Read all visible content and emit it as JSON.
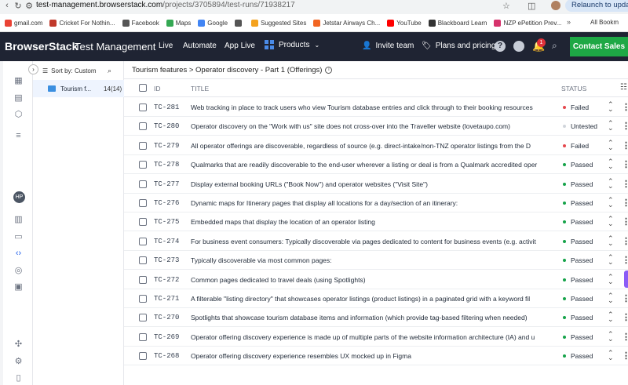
{
  "browser": {
    "url_host": "test-management.browserstack.com",
    "url_path": "/projects/3705894/test-runs/71938217",
    "relaunch_label": "Relaunch to update",
    "bookmarks": [
      {
        "label": "gmail.com",
        "color": "#ea4335"
      },
      {
        "label": "Cricket For Nothin...",
        "color": "#c0392b"
      },
      {
        "label": "Facebook",
        "color": "#555555"
      },
      {
        "label": "Maps",
        "color": "#34a853"
      },
      {
        "label": "Google",
        "color": "#4285f4"
      },
      {
        "label": "",
        "color": "#555555"
      },
      {
        "label": "Suggested Sites",
        "color": "#f4a21e"
      },
      {
        "label": "Jetstar Airways Ch...",
        "color": "#f26522"
      },
      {
        "label": "YouTube",
        "color": "#ff0000"
      },
      {
        "label": "Blackboard Learn",
        "color": "#333333"
      },
      {
        "label": "NZP ePetition Prev...",
        "color": "#d6336c"
      }
    ],
    "bookmarks_all": "All Bookm"
  },
  "topnav": {
    "logo": "BrowserStack",
    "product": "Test Management",
    "links": [
      "Live",
      "Automate",
      "App Live"
    ],
    "products_label": "Products",
    "invite_label": "Invite team",
    "plans_label": "Plans and pricing",
    "notification_count": "1",
    "contact_label": "Contact Sales",
    "help_glyph": "?"
  },
  "rail": {
    "avatar_initials": "HP"
  },
  "folders": {
    "sort_label": "Sort by: Custom",
    "items": [
      {
        "name": "Tourism f...",
        "count": "14(14)"
      }
    ]
  },
  "main": {
    "breadcrumb": "Tourism features > Operator discovery - Part 1 (Offerings)",
    "columns": {
      "id": "ID",
      "title": "TITLE",
      "status": "STATUS"
    },
    "rows": [
      {
        "id": "TC-281",
        "title": "Web tracking in place to track users who view Tourism database entries and click through to their booking resources",
        "status": "Failed",
        "status_color": "#e5484d"
      },
      {
        "id": "TC-280",
        "title": "Operator discovery on the \"Work with us\" site does not cross-over into the Traveller website (lovetaupo.com)",
        "status": "Untested",
        "status_color": "#d1d5db"
      },
      {
        "id": "TC-279",
        "title": "All operator offerings are discoverable, regardless of source (e.g. direct-intake/non-TNZ operator listings from the D",
        "status": "Failed",
        "status_color": "#e5484d"
      },
      {
        "id": "TC-278",
        "title": "Qualmarks that are readily discoverable to the end-user wherever a listing or deal is from a Qualmark accredited oper",
        "status": "Passed",
        "status_color": "#16a34a"
      },
      {
        "id": "TC-277",
        "title": "Display external booking URLs (\"Book Now\") and operator websites (\"Visit Site\")",
        "status": "Passed",
        "status_color": "#16a34a"
      },
      {
        "id": "TC-276",
        "title": "Dynamic maps for Itinerary pages that display all locations for a day/section of an itinerary:",
        "status": "Passed",
        "status_color": "#16a34a"
      },
      {
        "id": "TC-275",
        "title": "Embedded maps that display the location of an operator listing",
        "status": "Passed",
        "status_color": "#16a34a"
      },
      {
        "id": "TC-274",
        "title": "For business event consumers: Typically discoverable via pages dedicated to content for business events (e.g. activit",
        "status": "Passed",
        "status_color": "#16a34a"
      },
      {
        "id": "TC-273",
        "title": "Typically discoverable via most common pages:",
        "status": "Passed",
        "status_color": "#16a34a"
      },
      {
        "id": "TC-272",
        "title": "Common pages dedicated to travel deals (using Spotlights)",
        "status": "Passed",
        "status_color": "#16a34a"
      },
      {
        "id": "TC-271",
        "title": "A filterable \"listing directory\" that showcases operator listings (product listings) in a paginated grid with a keyword fil",
        "status": "Passed",
        "status_color": "#16a34a"
      },
      {
        "id": "TC-270",
        "title": "Spotlights that showcase tourism database items and information (which provide tag-based filtering when needed)",
        "status": "Passed",
        "status_color": "#16a34a"
      },
      {
        "id": "TC-269",
        "title": "Operator offering discovery experience is made up of multiple parts of the website information architecture (IA) and u",
        "status": "Passed",
        "status_color": "#16a34a"
      },
      {
        "id": "TC-268",
        "title": "Operator offering discovery experience resembles UX mocked up in Figma",
        "status": "Passed",
        "status_color": "#16a34a"
      }
    ]
  }
}
